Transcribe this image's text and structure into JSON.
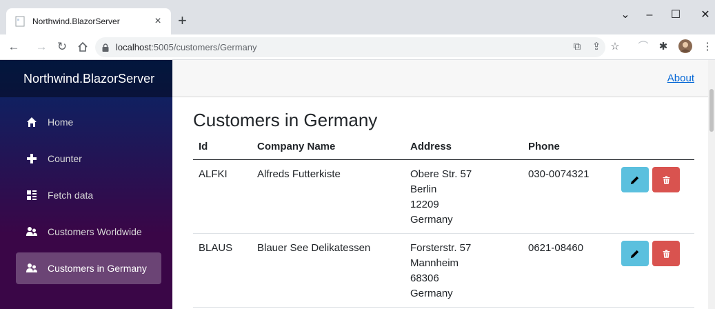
{
  "browser": {
    "tab_title": "Northwind.BlazorServer",
    "tab_close": "×",
    "new_tab": "+",
    "url_host": "localhost",
    "url_rest": ":5005/customers/Germany",
    "controls": {
      "chevron": "⌄",
      "minimize": "–",
      "maximize": "☐",
      "close": "✕"
    }
  },
  "app": {
    "brand": "Northwind.BlazorServer",
    "about": "About",
    "nav": [
      {
        "label": "Home",
        "icon": "home-icon"
      },
      {
        "label": "Counter",
        "icon": "plus-icon"
      },
      {
        "label": "Fetch data",
        "icon": "list-rich-icon"
      },
      {
        "label": "Customers Worldwide",
        "icon": "people-icon"
      },
      {
        "label": "Customers in Germany",
        "icon": "people-icon",
        "active": true
      }
    ]
  },
  "page": {
    "title": "Customers in Germany",
    "columns": [
      "Id",
      "Company Name",
      "Address",
      "Phone"
    ],
    "rows": [
      {
        "id": "ALFKI",
        "company": "Alfreds Futterkiste",
        "street": "Obere Str. 57",
        "city": "Berlin",
        "postal": "12209",
        "country": "Germany",
        "phone": "030-0074321"
      },
      {
        "id": "BLAUS",
        "company": "Blauer See Delikatessen",
        "street": "Forsterstr. 57",
        "city": "Mannheim",
        "postal": "68306",
        "country": "Germany",
        "phone": "0621-08460"
      }
    ]
  },
  "colors": {
    "edit": "#5bc0de",
    "delete": "#d9534f",
    "link": "#0366d6"
  }
}
